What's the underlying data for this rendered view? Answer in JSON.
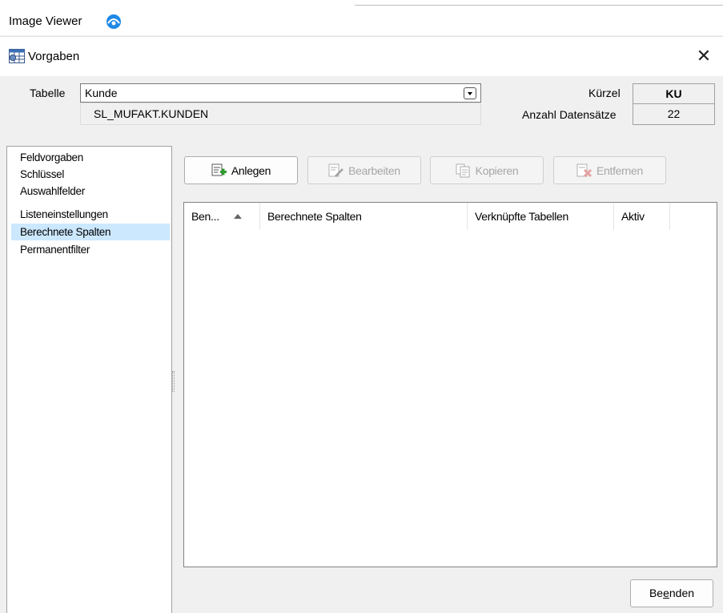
{
  "app": {
    "title": "Image Viewer",
    "icon": "viewer-badge-icon"
  },
  "dialog": {
    "title": "Vorgaben",
    "icon": "grid-settings-icon",
    "close_symbol": "✕"
  },
  "header": {
    "tabelle_label": "Tabelle",
    "tabelle_value": "Kunde",
    "table_name": "SL_MUFAKT.KUNDEN",
    "kuerzel_label": "Kürzel",
    "kuerzel_value": "KU",
    "anzahl_label": "Anzahl Datensätze",
    "anzahl_value": "22"
  },
  "nav": {
    "items": [
      {
        "label": "Feldvorgaben",
        "selected": false
      },
      {
        "label": "Schlüssel",
        "selected": false
      },
      {
        "label": "Auswahlfelder",
        "selected": false
      },
      {
        "label": "Listeneinstellungen",
        "selected": false
      },
      {
        "label": "Berechnete Spalten",
        "selected": true
      },
      {
        "label": "Permanentfilter",
        "selected": false
      }
    ]
  },
  "toolbar": {
    "anlegen": "Anlegen",
    "bearbeiten": "Bearbeiten",
    "kopieren": "Kopieren",
    "entfernen": "Entfernen"
  },
  "list": {
    "columns": [
      "Ben...",
      "Berechnete Spalten",
      "Verknüpfte Tabellen",
      "Aktiv"
    ],
    "sort_column": "Ben...",
    "sort_direction": "ascending",
    "rows": []
  },
  "footer": {
    "beenden_pre": "Be",
    "beenden_mnemonic": "e",
    "beenden_post": "nden"
  },
  "colors": {
    "selection": "#cce8ff",
    "add_icon_green": "#2e9e2e",
    "remove_icon_red": "#d9534f",
    "viewer_icon_blue": "#1e88e5"
  }
}
